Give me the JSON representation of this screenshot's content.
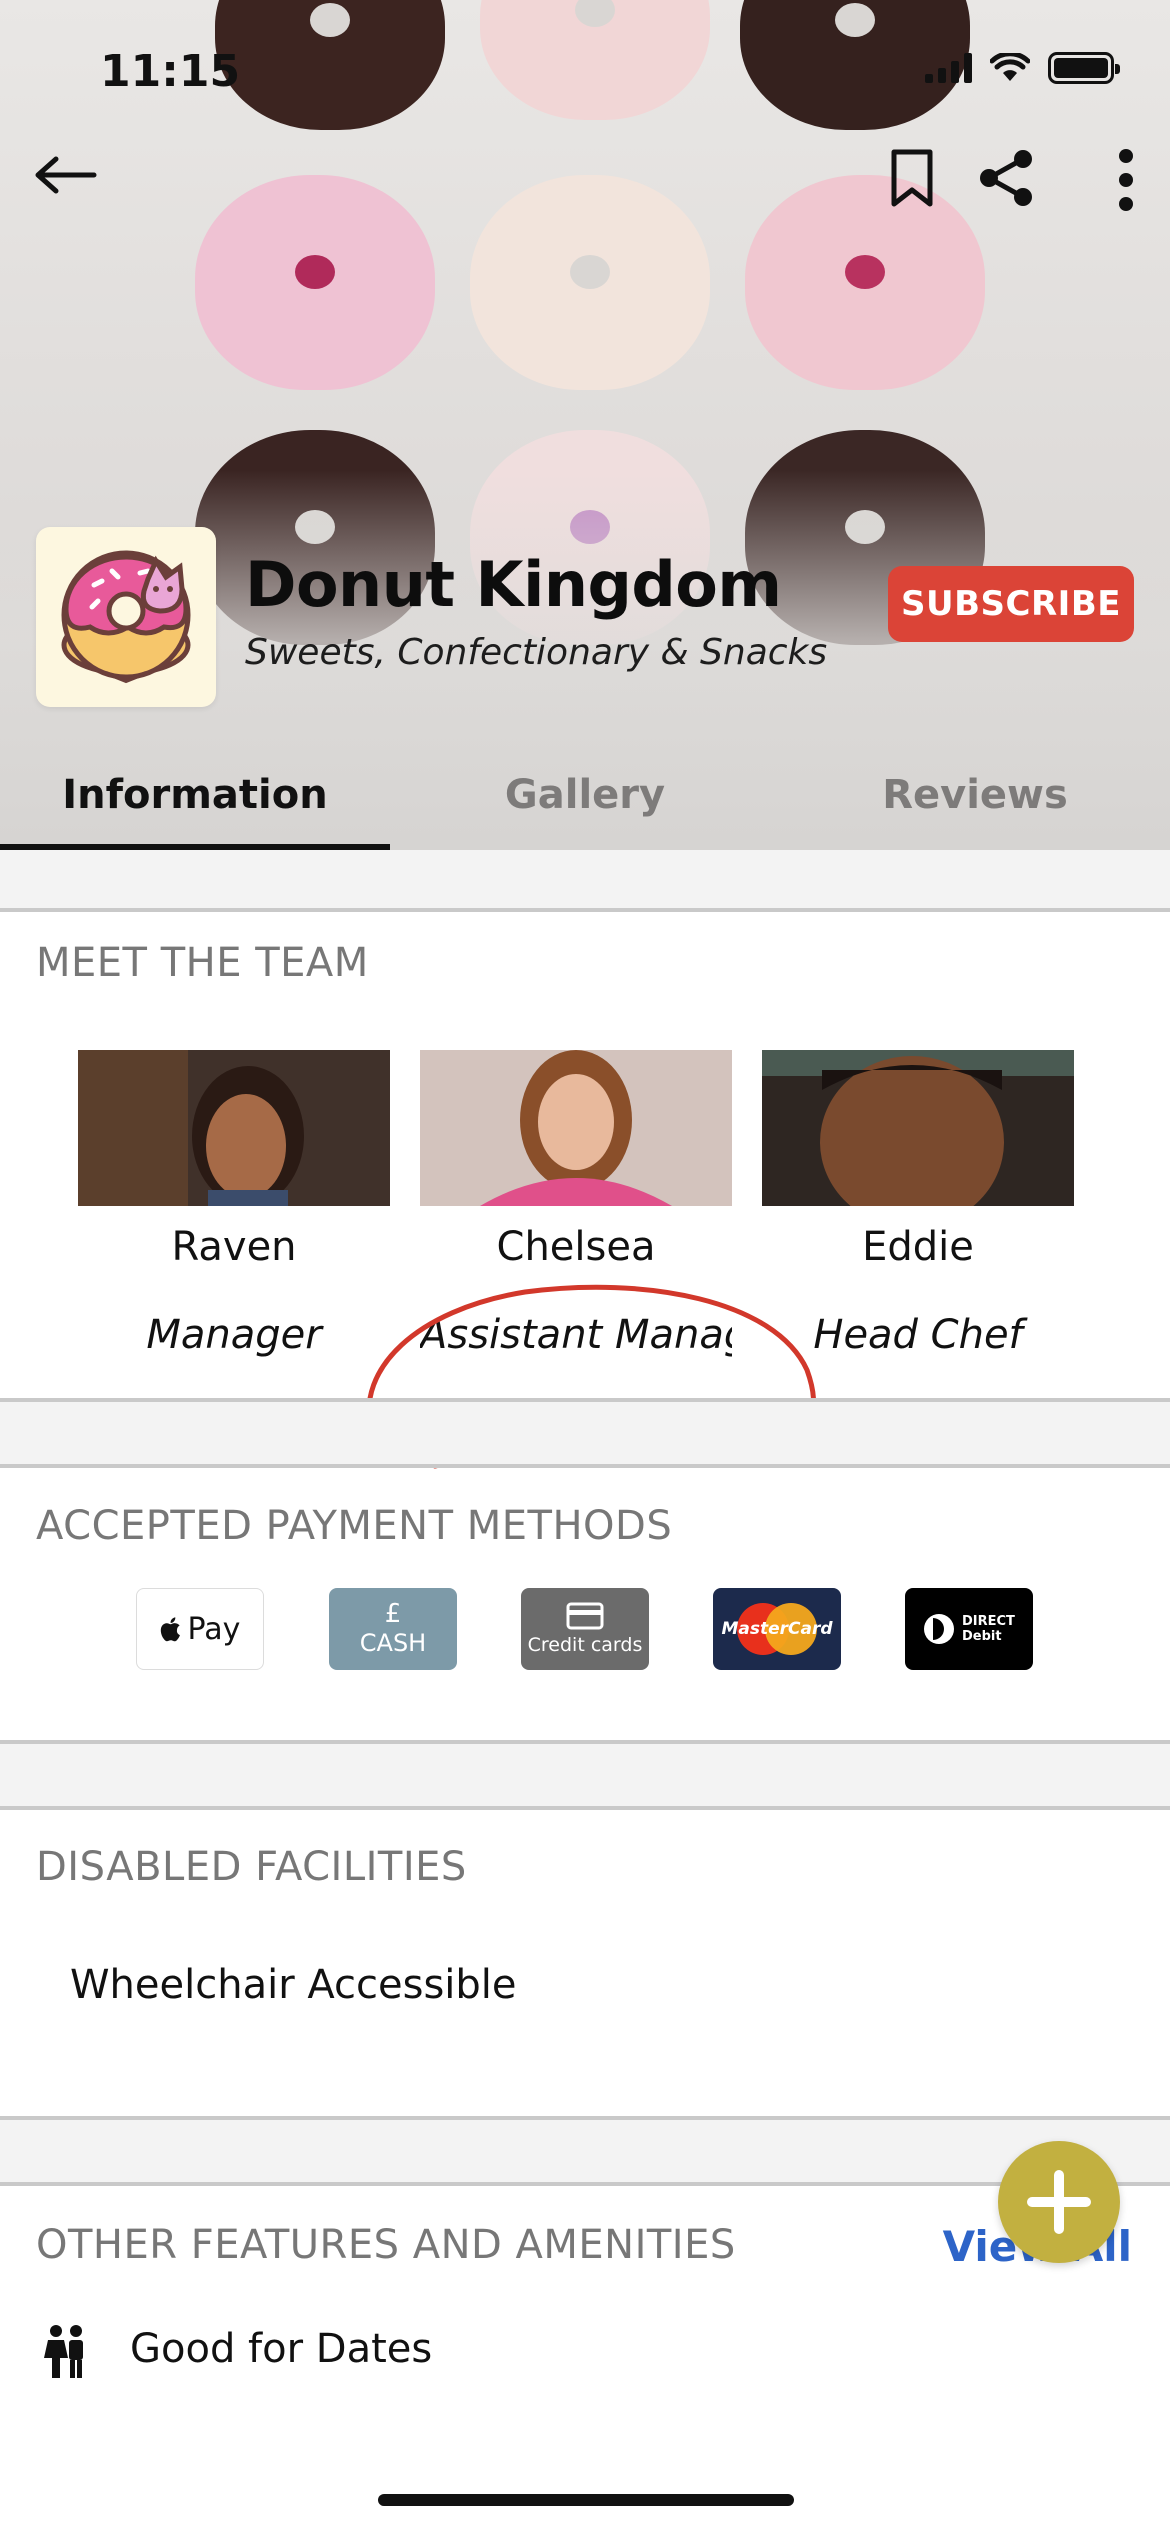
{
  "status_bar": {
    "time": "11:15"
  },
  "header": {
    "business_name": "Donut Kingdom",
    "category": "Sweets, Confectionary & Snacks",
    "subscribe_label": "SUBSCRIBE"
  },
  "tabs": [
    {
      "label": "Information",
      "active": true
    },
    {
      "label": "Gallery",
      "active": false
    },
    {
      "label": "Reviews",
      "active": false
    }
  ],
  "team": {
    "title": "MEET THE TEAM",
    "members": [
      {
        "name": "Raven",
        "role": "Manager"
      },
      {
        "name": "Chelsea",
        "role": "Assistant Manager"
      },
      {
        "name": "Eddie",
        "role": "Head Chef"
      }
    ]
  },
  "payments": {
    "title": "ACCEPTED PAYMENT METHODS",
    "methods": [
      {
        "label": "Pay",
        "icon": "apple-pay-icon"
      },
      {
        "symbol": "£",
        "label": "CASH",
        "icon": "cash-icon"
      },
      {
        "label": "Credit cards",
        "icon": "credit-card-icon"
      },
      {
        "label": "MasterCard",
        "icon": "mastercard-icon"
      },
      {
        "label": "DIRECT Debit",
        "icon": "direct-debit-icon"
      }
    ]
  },
  "disabled_facilities": {
    "title": "DISABLED FACILITIES",
    "items": [
      "Wheelchair Accessible"
    ]
  },
  "amenities": {
    "title": "OTHER FEATURES AND AMENITIES",
    "view_all_label": "View All",
    "items": [
      {
        "label": "Good for Dates",
        "icon": "couple-icon"
      }
    ]
  },
  "colors": {
    "subscribe": "#db4437",
    "link": "#2d64c8",
    "fab": "#c2b040",
    "annotation": "#d2382b"
  }
}
